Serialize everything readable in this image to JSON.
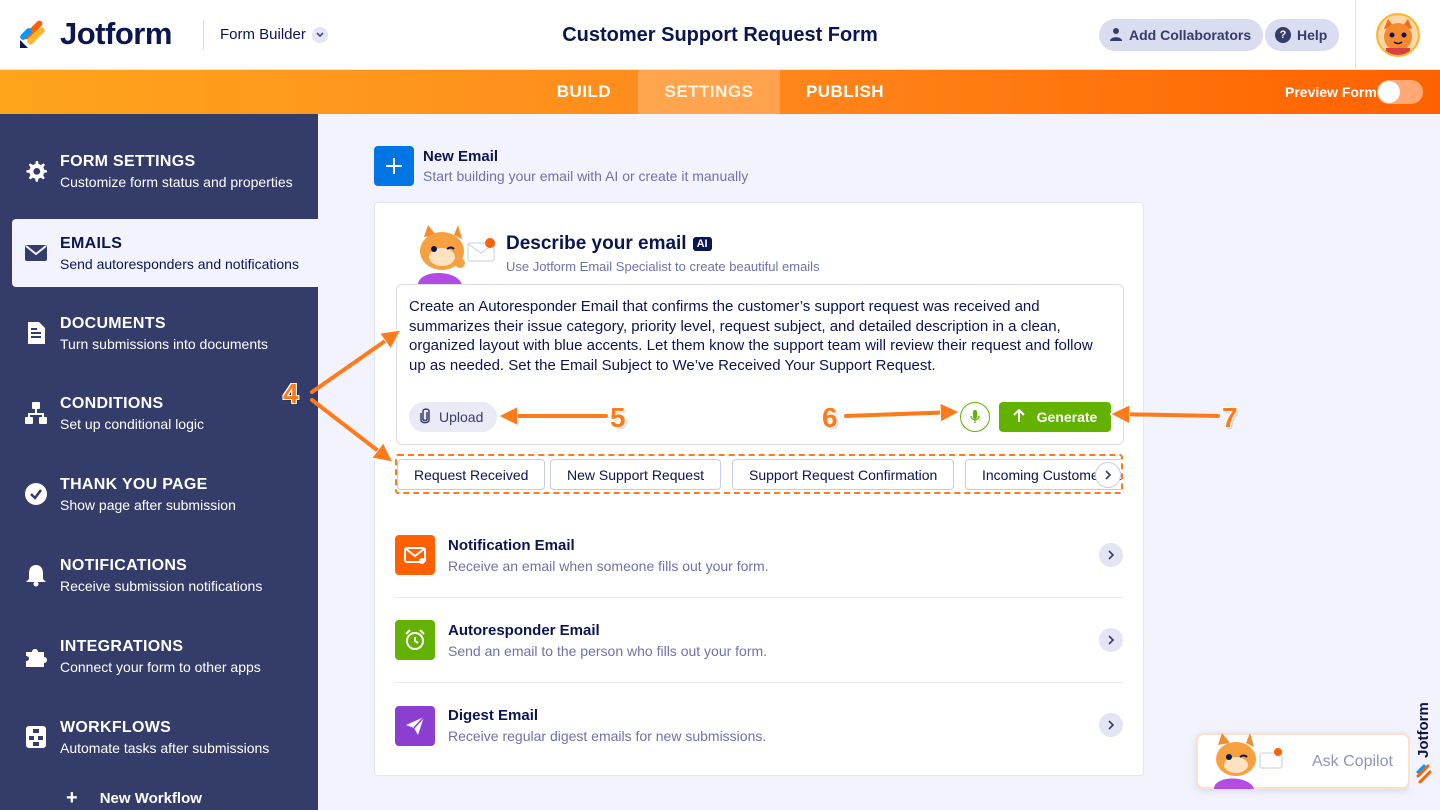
{
  "app": {
    "logo_text": "Jotform",
    "builder_label": "Form Builder",
    "form_title": "Customer Support Request Form",
    "add_collaborators": "Add Collaborators",
    "help": "Help"
  },
  "nav": {
    "tabs": [
      "BUILD",
      "SETTINGS",
      "PUBLISH"
    ],
    "active_tab": "SETTINGS",
    "preview_label": "Preview Form",
    "preview_on": false
  },
  "sidebar": {
    "items": [
      {
        "title": "FORM SETTINGS",
        "subtitle": "Customize form status and properties",
        "icon": "gear-icon"
      },
      {
        "title": "EMAILS",
        "subtitle": "Send autoresponders and notifications",
        "icon": "envelope-icon"
      },
      {
        "title": "DOCUMENTS",
        "subtitle": "Turn submissions into documents",
        "icon": "document-icon"
      },
      {
        "title": "CONDITIONS",
        "subtitle": "Set up conditional logic",
        "icon": "conditions-icon"
      },
      {
        "title": "THANK YOU PAGE",
        "subtitle": "Show page after submission",
        "icon": "check-circle-icon"
      },
      {
        "title": "NOTIFICATIONS",
        "subtitle": "Receive submission notifications",
        "icon": "bell-icon"
      },
      {
        "title": "INTEGRATIONS",
        "subtitle": "Connect your form to other apps",
        "icon": "puzzle-icon"
      },
      {
        "title": "WORKFLOWS",
        "subtitle": "Automate tasks after submissions",
        "icon": "workflow-icon"
      }
    ],
    "active_item": "EMAILS",
    "new_workflow": "New Workflow"
  },
  "new_email": {
    "title": "New Email",
    "subtitle": "Start building your email with AI or create it manually"
  },
  "describe": {
    "title": "Describe your email",
    "badge": "AI",
    "subtitle": "Use Jotform Email Specialist to create beautiful emails",
    "prompt_text": "Create an Autoresponder Email that confirms the customer’s support request was received and summarizes their issue category, priority level, request subject, and detailed description in a clean, organized layout with blue accents. Let them know the support team will review their request and follow up as needed. Set the Email Subject to We’ve Received Your Support Request.",
    "upload_label": "Upload",
    "generate_label": "Generate"
  },
  "suggestions": [
    "Request Received",
    "New Support Request",
    "Support Request Confirmation",
    "Incoming Customer Support Request"
  ],
  "email_types": [
    {
      "title": "Notification Email",
      "subtitle": "Receive an email when someone fills out your form.",
      "color": "#ff6100",
      "icon": "notification-envelope-icon"
    },
    {
      "title": "Autoresponder Email",
      "subtitle": "Send an email to the person who fills out your form.",
      "color": "#64b200",
      "icon": "alarm-clock-icon"
    },
    {
      "title": "Digest Email",
      "subtitle": "Receive regular digest emails for new submissions.",
      "color": "#8b3fd1",
      "icon": "paper-plane-icon"
    }
  ],
  "copilot": {
    "label": "Ask Copilot"
  },
  "annotations": [
    "4",
    "5",
    "6",
    "7"
  ],
  "colors": {
    "navy": "#0a1551",
    "sidebar": "#343c6a",
    "orange": "#ff7a1a",
    "green": "#64b200",
    "blue": "#0075e3"
  }
}
